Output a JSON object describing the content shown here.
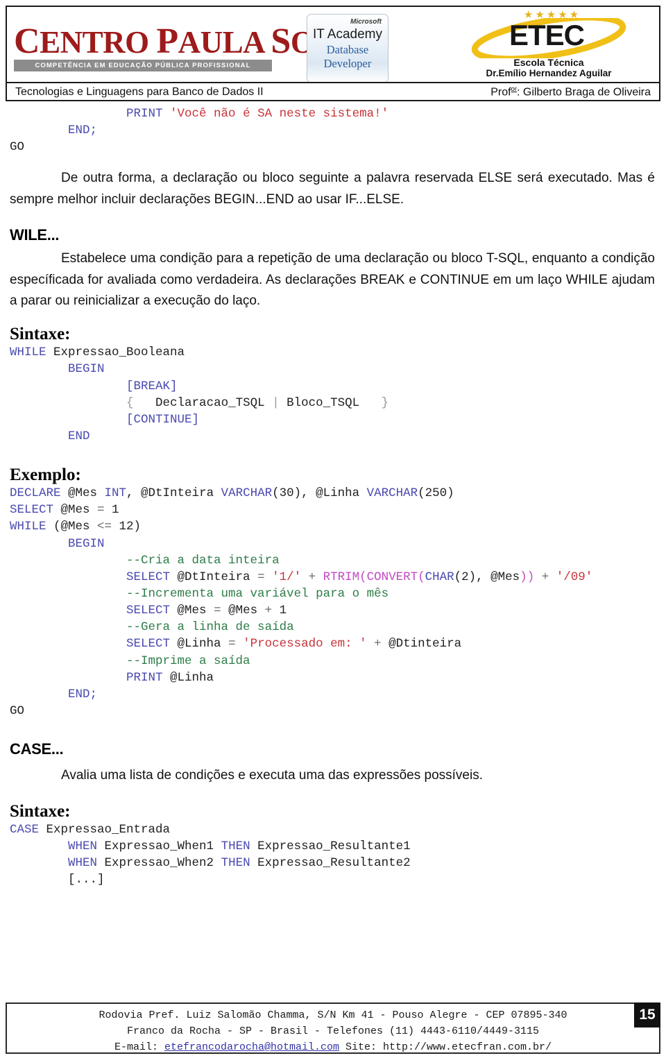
{
  "header": {
    "cps_logo": {
      "wordmark": "CENTRO PAULA SOUZA",
      "tagline": "COMPETÊNCIA EM EDUCAÇÃO PÚBLICA PROFISSIONAL"
    },
    "ms_badge": {
      "brand": "Microsoft",
      "line1": "IT Academy",
      "line2": "Database",
      "line3": "Developer"
    },
    "etec_logo": {
      "stars": "★★★★★",
      "wordmark": "ETEC",
      "sub1": "Escola Técnica",
      "sub2": "Dr.Emílio Hernandez Aguilar"
    },
    "course_title": "Tecnologias e Linguagens para Banco de Dados II",
    "professor_prefix": "Prof",
    "professor_suffix": "or",
    "professor_name": ": Gilberto Braga de Oliveira"
  },
  "content": {
    "top_code": [
      {
        "indent": 4,
        "tokens": [
          {
            "t": "PRINT ",
            "c": "kw"
          },
          {
            "t": "'Você não é SA neste sistema!'",
            "c": "str"
          }
        ]
      },
      {
        "indent": 2,
        "tokens": [
          {
            "t": "END",
            "c": "kw"
          },
          {
            "t": ";",
            "c": "kw"
          }
        ]
      },
      {
        "indent": 0,
        "tokens": [
          {
            "t": "GO",
            "c": "plain"
          }
        ]
      }
    ],
    "para_else": "De outra forma, a declaração ou bloco seguinte a palavra reservada ELSE  será executado. Mas é sempre melhor incluir declarações BEGIN...END ao usar IF...ELSE.",
    "while_heading": "WILE...",
    "para_while": "Estabelece uma condição para a repetição de uma declaração ou bloco T-SQL, enquanto a condição específicada for avaliada como verdadeira. As declarações BREAK e CONTINUE em um laço WHILE  ajudam a parar ou reinicializar a execução do laço.",
    "sintaxe_label_1": "Sintaxe:",
    "while_syntax_code": [
      {
        "indent": 0,
        "tokens": [
          {
            "t": "WHILE ",
            "c": "kw"
          },
          {
            "t": "Expressao_Booleana",
            "c": "plain"
          }
        ]
      },
      {
        "indent": 2,
        "tokens": [
          {
            "t": "BEGIN",
            "c": "kw"
          }
        ]
      },
      {
        "indent": 4,
        "tokens": [
          {
            "t": "[BREAK]",
            "c": "kw"
          }
        ]
      },
      {
        "indent": 4,
        "tokens": [
          {
            "t": "{",
            "c": "faint"
          },
          {
            "t": "   Declaracao_TSQL ",
            "c": "plain"
          },
          {
            "t": "| ",
            "c": "faint"
          },
          {
            "t": "Bloco_TSQL   ",
            "c": "plain"
          },
          {
            "t": "}",
            "c": "faint"
          }
        ]
      },
      {
        "indent": 4,
        "tokens": [
          {
            "t": "[CONTINUE]",
            "c": "kw"
          }
        ]
      },
      {
        "indent": 2,
        "tokens": [
          {
            "t": "END",
            "c": "kw"
          }
        ]
      }
    ],
    "exemplo_label": "Exemplo:",
    "while_example_code": [
      {
        "indent": 0,
        "tokens": [
          {
            "t": "DECLARE ",
            "c": "kw"
          },
          {
            "t": "@Mes ",
            "c": "plain"
          },
          {
            "t": "INT",
            "c": "kw"
          },
          {
            "t": ", @DtInteira ",
            "c": "plain"
          },
          {
            "t": "VARCHAR",
            "c": "kw"
          },
          {
            "t": "(30), @Linha ",
            "c": "plain"
          },
          {
            "t": "VARCHAR",
            "c": "kw"
          },
          {
            "t": "(250)",
            "c": "plain"
          }
        ]
      },
      {
        "indent": 0,
        "tokens": [
          {
            "t": "SELECT ",
            "c": "kw"
          },
          {
            "t": "@Mes ",
            "c": "plain"
          },
          {
            "t": "= ",
            "c": "op"
          },
          {
            "t": "1",
            "c": "plain"
          }
        ]
      },
      {
        "indent": 0,
        "tokens": [
          {
            "t": "WHILE ",
            "c": "kw"
          },
          {
            "t": "(@Mes ",
            "c": "plain"
          },
          {
            "t": "<= ",
            "c": "op"
          },
          {
            "t": "12)",
            "c": "plain"
          }
        ]
      },
      {
        "indent": 2,
        "tokens": [
          {
            "t": "BEGIN",
            "c": "kw"
          }
        ]
      },
      {
        "indent": 4,
        "tokens": [
          {
            "t": "--Cria a data inteira",
            "c": "cmt"
          }
        ]
      },
      {
        "indent": 4,
        "tokens": [
          {
            "t": "SELECT ",
            "c": "kw"
          },
          {
            "t": "@DtInteira ",
            "c": "plain"
          },
          {
            "t": "= ",
            "c": "op"
          },
          {
            "t": "'1/'",
            "c": "str"
          },
          {
            "t": " + ",
            "c": "op"
          },
          {
            "t": "RTRIM(CONVERT(",
            "c": "fn"
          },
          {
            "t": "CHAR",
            "c": "kw"
          },
          {
            "t": "(2), @Mes",
            "c": "plain"
          },
          {
            "t": "))",
            "c": "fn"
          },
          {
            "t": " + ",
            "c": "op"
          },
          {
            "t": "'/09'",
            "c": "str"
          }
        ]
      },
      {
        "indent": 4,
        "tokens": [
          {
            "t": "--Incrementa uma variável para o mês",
            "c": "cmt"
          }
        ]
      },
      {
        "indent": 4,
        "tokens": [
          {
            "t": "SELECT ",
            "c": "kw"
          },
          {
            "t": "@Mes ",
            "c": "plain"
          },
          {
            "t": "= ",
            "c": "op"
          },
          {
            "t": "@Mes ",
            "c": "plain"
          },
          {
            "t": "+ ",
            "c": "op"
          },
          {
            "t": "1",
            "c": "plain"
          }
        ]
      },
      {
        "indent": 4,
        "tokens": [
          {
            "t": "--Gera a linha de saída",
            "c": "cmt"
          }
        ]
      },
      {
        "indent": 4,
        "tokens": [
          {
            "t": "SELECT ",
            "c": "kw"
          },
          {
            "t": "@Linha ",
            "c": "plain"
          },
          {
            "t": "= ",
            "c": "op"
          },
          {
            "t": "'Processado em: '",
            "c": "str"
          },
          {
            "t": " + ",
            "c": "op"
          },
          {
            "t": "@Dtinteira",
            "c": "plain"
          }
        ]
      },
      {
        "indent": 4,
        "tokens": [
          {
            "t": "--Imprime a saída",
            "c": "cmt"
          }
        ]
      },
      {
        "indent": 4,
        "tokens": [
          {
            "t": "PRINT ",
            "c": "kw"
          },
          {
            "t": "@Linha",
            "c": "plain"
          }
        ]
      },
      {
        "indent": 2,
        "tokens": [
          {
            "t": "END;",
            "c": "kw"
          }
        ]
      },
      {
        "indent": 0,
        "tokens": [
          {
            "t": "GO",
            "c": "plain"
          }
        ]
      }
    ],
    "case_heading": "CASE...",
    "para_case": "Avalia uma lista de condições e executa uma das expressões possíveis.",
    "sintaxe_label_2": "Sintaxe:",
    "case_syntax_code": [
      {
        "indent": 0,
        "tokens": [
          {
            "t": "CASE ",
            "c": "kw"
          },
          {
            "t": "Expressao_Entrada",
            "c": "plain"
          }
        ]
      },
      {
        "indent": 2,
        "tokens": [
          {
            "t": "WHEN ",
            "c": "kw"
          },
          {
            "t": "Expressao_When1 ",
            "c": "plain"
          },
          {
            "t": "THEN ",
            "c": "kw"
          },
          {
            "t": "Expressao_Resultante1",
            "c": "plain"
          }
        ]
      },
      {
        "indent": 2,
        "tokens": [
          {
            "t": "WHEN ",
            "c": "kw"
          },
          {
            "t": "Expressao_When2 ",
            "c": "plain"
          },
          {
            "t": "THEN ",
            "c": "kw"
          },
          {
            "t": "Expressao_Resultante2",
            "c": "plain"
          }
        ]
      },
      {
        "indent": 2,
        "tokens": [
          {
            "t": "[...]",
            "c": "plain"
          }
        ]
      }
    ]
  },
  "footer": {
    "line1": "Rodovia Pref. Luiz Salomão Chamma, S/N Km 41 - Pouso Alegre - CEP 07895-340",
    "line2": "Franco da Rocha - SP - Brasil - Telefones (11) 4443-6110/4449-3115",
    "line3_prefix": "E-mail: ",
    "line3_email": "etefrancodarocha@hotmail.com",
    "line3_suffix": " Site: http://www.etecfran.com.br/",
    "page_number": "15"
  },
  "colors": {
    "keyword": "#4a4ab0",
    "string": "#c7343a",
    "comment": "#2e7d49",
    "function": "#c24bc2",
    "cps_red": "#9e1b1b",
    "etec_gold": "#e8b21c",
    "ms_blue": "#2b5d9e"
  }
}
